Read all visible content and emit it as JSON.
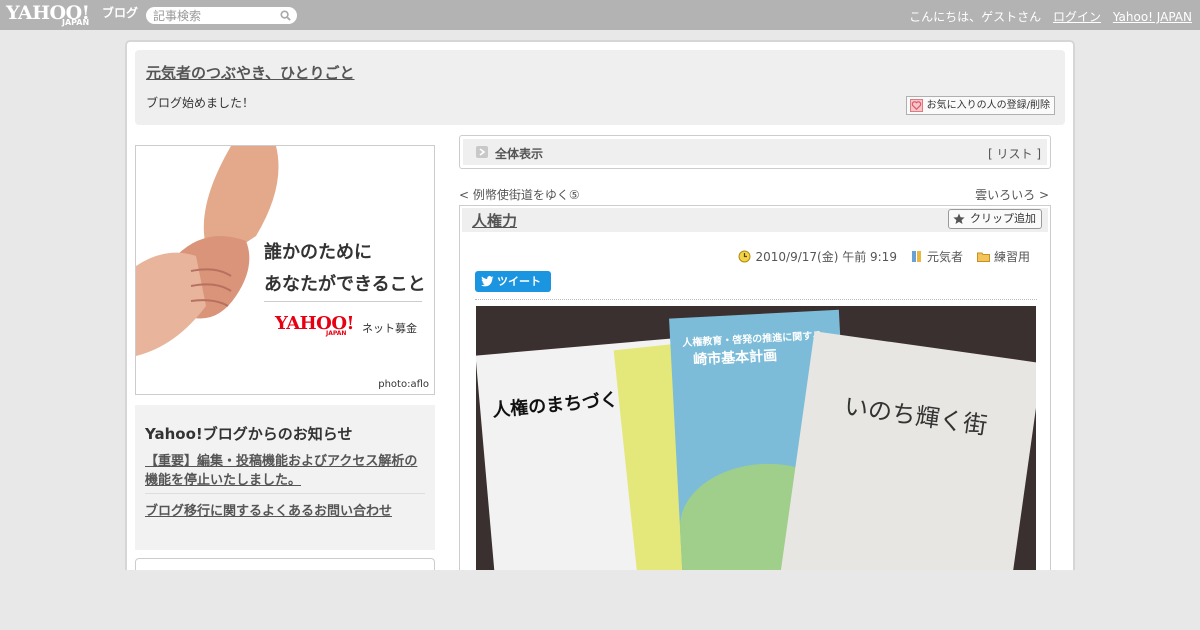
{
  "topbar": {
    "logo": "YAHOO!",
    "logo_sub": "JAPAN",
    "logo_blog": "ブログ",
    "search_placeholder": "記事検索",
    "greeting": "こんにちは、ゲストさん",
    "login": "ログイン",
    "yahoo_japan": "Yahoo! JAPAN"
  },
  "header": {
    "title": "元気者のつぶやき、ひとりごと",
    "description": "ブログ始めました！",
    "favorite_button": "お気に入りの人の登録/削除"
  },
  "banner": {
    "line1": "誰かのために",
    "line2": "あなたができること",
    "logo": "YAHOO!",
    "logo_sub": "JAPAN",
    "service": "ネット募金",
    "credit": "photo:aflo"
  },
  "notice": {
    "title": "Yahoo!ブログからのお知らせ",
    "link1": "【重要】編集・投稿機能およびアクセス解析の機能を停止いたしました。",
    "link2": "ブログ移行に関するよくあるお問い合わせ"
  },
  "main": {
    "view_all": "全体表示",
    "list_open": "[",
    "list_label": "リスト",
    "list_close": "]",
    "prev_arrow": "<",
    "prev_link": "例幣使街道をゆく⑤",
    "next_link": "雲いろいろ",
    "next_arrow": ">"
  },
  "article": {
    "title": "人権力",
    "clip_button": "クリップ追加",
    "date": "2010/9/17(金) 午前 9:19",
    "author": "元気者",
    "category": "練習用",
    "tweet": "ツイート",
    "photo_left_title": "人権のまちづくり講演会",
    "photo_mid_text1": "人権教育・啓発の推進に関する",
    "photo_mid_text2": "崎市基本計画",
    "photo_right_title": "いのち輝く街"
  }
}
